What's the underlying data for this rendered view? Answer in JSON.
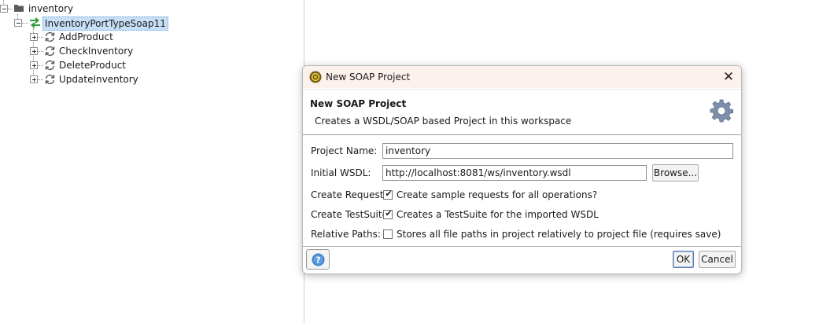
{
  "tree": {
    "root_label": "inventory",
    "interface_label": "InventoryPortTypeSoap11",
    "operations": [
      "AddProduct",
      "CheckInventory",
      "DeleteProduct",
      "UpdateInventory"
    ]
  },
  "dialog": {
    "window_title": "New SOAP Project",
    "banner_title": "New SOAP Project",
    "banner_description": "Creates a WSDL/SOAP based Project in this workspace",
    "project_name_label": "Project Name:",
    "project_name_value": "inventory",
    "initial_wsdl_label": "Initial WSDL:",
    "initial_wsdl_value": "http://localhost:8081/ws/inventory.wsdl",
    "browse_label": "Browse...",
    "create_requests_label": "Create Requests:",
    "create_requests_text": "Create sample requests for all operations?",
    "create_requests_checked": true,
    "create_testsuite_label": "Create TestSuite:",
    "create_testsuite_text": "Creates a TestSuite for the imported WSDL",
    "create_testsuite_checked": true,
    "relative_paths_label": "Relative Paths:",
    "relative_paths_text": "Stores all file paths in project relatively to project file (requires save)",
    "relative_paths_checked": false,
    "ok_label": "OK",
    "cancel_label": "Cancel",
    "close_glyph": "✕"
  },
  "icons": {
    "folder": "folder-icon",
    "interface": "interface-arrows-icon",
    "operation": "operation-cycle-icon",
    "soap_logo": "soapui-logo-icon",
    "gear": "gear-icon",
    "help": "help-icon"
  },
  "colors": {
    "selection": "#c7dff7",
    "titlebar": "#fdf1ee",
    "interface_icon": "#2e9d3a",
    "help_icon": "#3d7fc4"
  }
}
